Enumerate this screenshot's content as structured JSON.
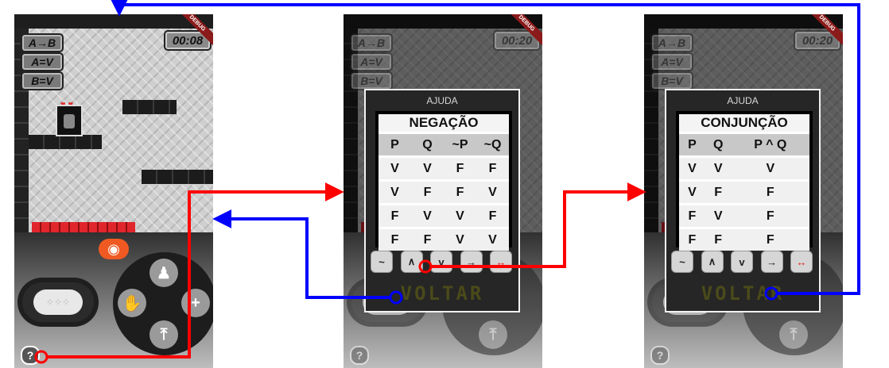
{
  "screens": [
    {
      "tags": [
        "A→B",
        "A=V",
        "B=V"
      ],
      "timer": "00:08",
      "debug": "DEBUG"
    },
    {
      "tags": [
        "A→B",
        "A=V",
        "B=V"
      ],
      "timer": "00:20",
      "debug": "DEBUG"
    },
    {
      "tags": [
        "A→B",
        "A=V",
        "B=V"
      ],
      "timer": "00:20",
      "debug": "DEBUG"
    }
  ],
  "controls": {
    "help": "?",
    "eye_icon": "eye-icon",
    "hand_icon": "hand-icon",
    "robot_icon": "robot-icon",
    "up_icon": "arrow-up-bar-icon"
  },
  "dialogs": [
    {
      "title": "AJUDA",
      "table_title": "NEGAÇÃO",
      "headers": [
        "P",
        "Q",
        "~P",
        "~Q"
      ],
      "rows": [
        [
          "V",
          "V",
          "F",
          "F"
        ],
        [
          "V",
          "F",
          "F",
          "V"
        ],
        [
          "F",
          "V",
          "V",
          "F"
        ],
        [
          "F",
          "F",
          "V",
          "V"
        ]
      ],
      "ops": [
        "~",
        "∧",
        "v",
        "→",
        "↔"
      ],
      "back": "VOLTAR"
    },
    {
      "title": "AJUDA",
      "table_title": "CONJUNÇÃO",
      "headers": [
        "P",
        "Q",
        "P ^ Q"
      ],
      "rows": [
        [
          "V",
          "V",
          "V"
        ],
        [
          "V",
          "F",
          "F"
        ],
        [
          "F",
          "V",
          "F"
        ],
        [
          "F",
          "F",
          "F"
        ]
      ],
      "ops": [
        "~",
        "∧",
        "v",
        "→",
        "↔"
      ],
      "back": "VOLTAR"
    }
  ],
  "colors": {
    "forward": "#ff0000",
    "back": "#0000ff",
    "eye": "#f05a22",
    "lava": "#c4161c"
  }
}
